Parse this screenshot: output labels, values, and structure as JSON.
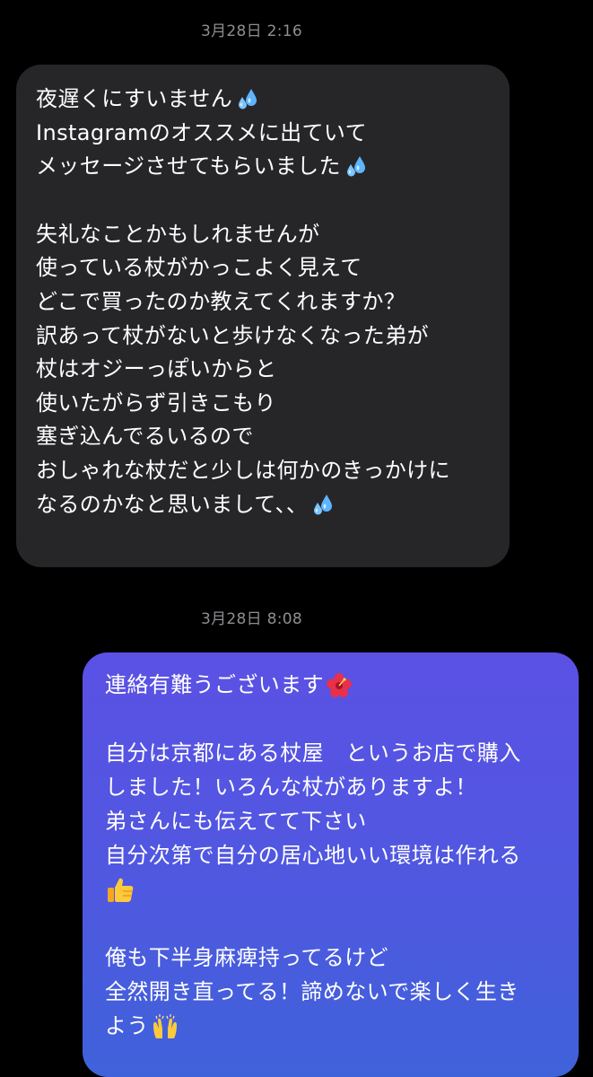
{
  "conversation": {
    "timestamp_1": "3月28日 2:16",
    "incoming_message": {
      "lines": [
        "夜遅くにすいません",
        "Instagramのオススメに出ていて",
        "メッセージさせてもらいました",
        "",
        "失礼なことかもしれませんが",
        "使っている杖がかっこよく見えて",
        "どこで買ったのか教えてくれますか？",
        "訳あって杖がないと歩けなくなった弟が",
        "杖はオジーっぽいからと",
        "使いたがらず引きこもり",
        "塞ぎ込んでるいるので",
        "おしゃれな杖だと少しは何かのきっかけに",
        "なるのかなと思いまして、、"
      ],
      "emojis": [
        "sweat-droplets-icon",
        "sweat-droplets-icon",
        "sweat-droplets-icon"
      ]
    },
    "timestamp_2": "3月28日 8:08",
    "outgoing_message": {
      "lines": [
        "連絡有難うございます",
        "",
        "自分は京都にある杖屋　というお店で購入",
        "しました！いろんな杖がありますよ！",
        "弟さんにも伝えてて下さい",
        "自分次第で自分の居心地いい環境は作れる",
        "",
        "",
        "俺も下半身麻痺持ってるけど",
        "全然開き直ってる！諦めないで楽しく生き",
        "よう"
      ],
      "emojis": [
        "hibiscus-icon",
        "thumbs-up-icon",
        "raising-hands-icon"
      ]
    },
    "colors": {
      "background": "#000000",
      "incoming_bubble": "#262628",
      "outgoing_bubble_top": "#5b51e4",
      "outgoing_bubble_bottom": "#3f62da",
      "timestamp": "#8e8e93"
    }
  }
}
